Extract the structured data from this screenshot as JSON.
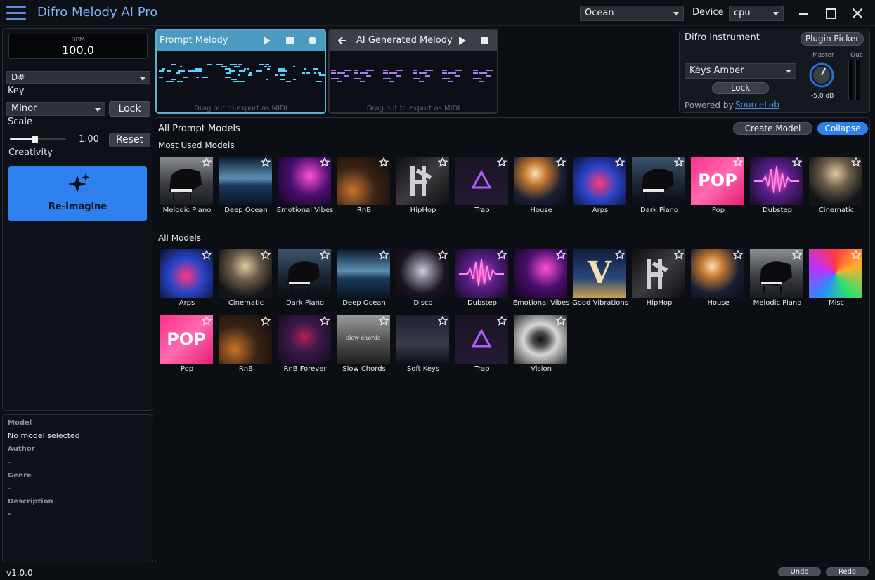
{
  "app": {
    "title": "Difro Melody AI Pro",
    "version": "v1.0.0"
  },
  "titlebar": {
    "theme": "Ocean",
    "device_label": "Device",
    "device": "cpu"
  },
  "controls": {
    "bpm_label": "BPM",
    "bpm": "100.0",
    "key": "D#",
    "key_label": "Key",
    "scale": "Minor",
    "lock_label": "Lock",
    "scale_label": "Scale",
    "creativity": "1.00",
    "creativity_fraction": 0.45,
    "reset_label": "Reset",
    "creativity_label": "Creativity",
    "reimagine_label": "Re-Imagine"
  },
  "model_info": {
    "model_key": "Model",
    "model_val": "No model selected",
    "author_key": "Author",
    "author_val": "-",
    "genre_key": "Genre",
    "genre_val": "-",
    "description_key": "Description",
    "description_val": "-"
  },
  "prompt_melody": {
    "title": "Prompt Melody",
    "hint": "Drag out to export as MIDI"
  },
  "ai_melody": {
    "title": "AI Generated Melody",
    "hint": "Drag out to export as MIDI"
  },
  "instrument": {
    "title": "Difro Instrument",
    "plugin_picker": "Plugin Picker",
    "preset": "Keys Amber",
    "lock_label": "Lock",
    "powered_by": "Powered by",
    "vendor": "SourceLab",
    "master_label": "Master",
    "master_value": "-5.0 dB",
    "out_label": "Out"
  },
  "models": {
    "title": "All Prompt Models",
    "create_label": "Create Model",
    "collapse_label": "Collapse",
    "most_used_title": "Most Used Models",
    "all_title": "All Models",
    "most_used": [
      {
        "label": "Melodic Piano",
        "art": "piano"
      },
      {
        "label": "Deep Ocean",
        "art": "ocean"
      },
      {
        "label": "Emotional Vibes",
        "art": "girl"
      },
      {
        "label": "RnB",
        "art": "rnb"
      },
      {
        "label": "HipHop",
        "art": "hiphop"
      },
      {
        "label": "Trap",
        "art": "trap"
      },
      {
        "label": "House",
        "art": "house"
      },
      {
        "label": "Arps",
        "art": "arps"
      },
      {
        "label": "Dark Piano",
        "art": "darkpiano"
      },
      {
        "label": "Pop",
        "art": "pop"
      },
      {
        "label": "Dubstep",
        "art": "dubstep"
      },
      {
        "label": "Cinematic",
        "art": "cinematic"
      }
    ],
    "all": [
      {
        "label": "Arps",
        "art": "arps"
      },
      {
        "label": "Cinematic",
        "art": "cinematic"
      },
      {
        "label": "Dark Piano",
        "art": "darkpiano"
      },
      {
        "label": "Deep Ocean",
        "art": "ocean"
      },
      {
        "label": "Disco",
        "art": "disco"
      },
      {
        "label": "Dubstep",
        "art": "dubstep"
      },
      {
        "label": "Emotional Vibes",
        "art": "girl"
      },
      {
        "label": "Good Vibrations",
        "art": "goodvibes"
      },
      {
        "label": "HipHop",
        "art": "hiphop"
      },
      {
        "label": "House",
        "art": "house"
      },
      {
        "label": "Melodic Piano",
        "art": "piano"
      },
      {
        "label": "Misc",
        "art": "misc"
      },
      {
        "label": "Pop",
        "art": "pop"
      },
      {
        "label": "RnB",
        "art": "rnb"
      },
      {
        "label": "RnB Forever",
        "art": "rnbforever"
      },
      {
        "label": "Slow Chords",
        "art": "slowchords"
      },
      {
        "label": "Soft Keys",
        "art": "softkeys"
      },
      {
        "label": "Trap",
        "art": "trap"
      },
      {
        "label": "Vision",
        "art": "vision"
      }
    ]
  },
  "art_text": {
    "pop": "POP",
    "goodvibes": "V",
    "slowchords": "slow chords"
  },
  "footer": {
    "undo_label": "Undo",
    "redo_label": "Redo"
  },
  "colors": {
    "accent": "#2d80ee",
    "prompt_header": "#4b9bc0",
    "prompt_notes": "#5fd0ff",
    "ai_notes": "#a77bf2",
    "title_text": "#7db4f2"
  }
}
